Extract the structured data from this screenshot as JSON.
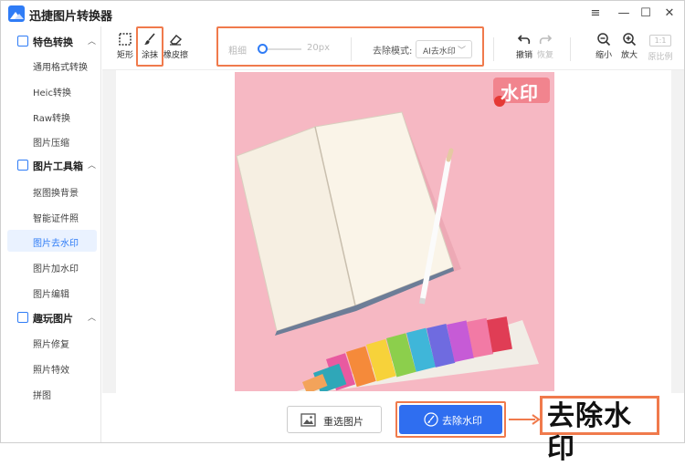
{
  "app": {
    "title": "迅捷图片转换器"
  },
  "window_controls": {
    "menu": "≡",
    "minimize": "—",
    "maximize": "☐",
    "close": "✕"
  },
  "sidebar": {
    "groups": [
      {
        "label": "特色转换",
        "items": [
          "通用格式转换",
          "Heic转换",
          "Raw转换",
          "图片压缩"
        ]
      },
      {
        "label": "图片工具箱",
        "items": [
          "抠图换背景",
          "智能证件照",
          "图片去水印",
          "图片加水印",
          "图片编辑"
        ]
      },
      {
        "label": "趣玩图片",
        "items": [
          "照片修复",
          "照片特效",
          "拼图"
        ]
      }
    ],
    "active_item": "图片去水印"
  },
  "toolbar": {
    "rect_label": "矩形",
    "smear_label": "涂抹",
    "eraser_label": "橡皮擦",
    "thickness_label": "粗细",
    "thickness_value": "20px",
    "mode_label": "去除模式:",
    "mode_value": "AI去水印",
    "undo_label": "撤销",
    "redo_label": "恢复",
    "zoom_out_label": "缩小",
    "zoom_in_label": "放大",
    "ratio_button": "1:1",
    "ratio_label": "原比例"
  },
  "canvas": {
    "watermark_text": "水印"
  },
  "bottom": {
    "reselect_label": "重选图片",
    "remove_label": "去除水印"
  },
  "callout": {
    "text": "去除水印"
  },
  "colors": {
    "accent": "#2f6ef0",
    "highlight": "#f07a4c",
    "photo_bg": "#f6b8c3"
  }
}
